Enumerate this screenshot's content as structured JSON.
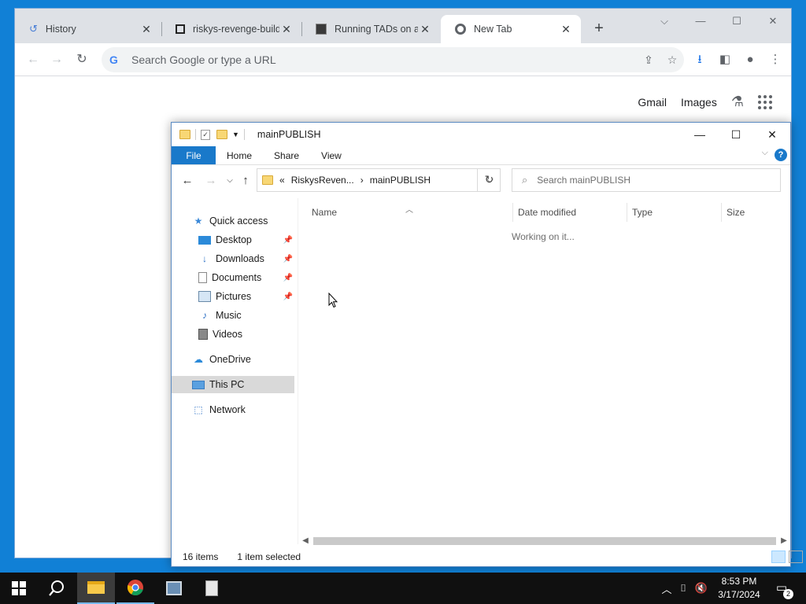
{
  "browser": {
    "tabs": [
      {
        "title": "History",
        "icon": "history-icon"
      },
      {
        "title": "riskys-revenge-build",
        "icon": "github-repo-icon"
      },
      {
        "title": "Running TADs on a re",
        "icon": "site-favicon"
      },
      {
        "title": "New Tab",
        "icon": "chrome-icon"
      }
    ],
    "omnibox_placeholder": "Search Google or type a URL",
    "ntp_links": {
      "gmail": "Gmail",
      "images": "Images"
    }
  },
  "explorer": {
    "title": "mainPUBLISH",
    "ribbon_tabs": [
      "File",
      "Home",
      "Share",
      "View"
    ],
    "help": "?",
    "breadcrumb": {
      "prefix": "«",
      "parent": "RiskysReven...",
      "separator": "›",
      "current": "mainPUBLISH"
    },
    "search_placeholder": "Search mainPUBLISH",
    "nav": {
      "quick_access": "Quick access",
      "pinned": [
        "Desktop",
        "Downloads",
        "Documents",
        "Pictures"
      ],
      "unpinned": [
        "Music",
        "Videos"
      ],
      "onedrive": "OneDrive",
      "this_pc": "This PC",
      "network": "Network"
    },
    "columns": [
      "Name",
      "Date modified",
      "Type",
      "Size"
    ],
    "loading_text": "Working on it...",
    "status": {
      "items": "16 items",
      "selected": "1 item selected"
    }
  },
  "taskbar": {
    "time": "8:53 PM",
    "date": "3/17/2024",
    "notification_count": "2"
  },
  "colors": {
    "desktop": "#1180d6",
    "taskbar": "#101010",
    "file_tab": "#1979ca",
    "selected_nav": "#d9d9d9"
  }
}
